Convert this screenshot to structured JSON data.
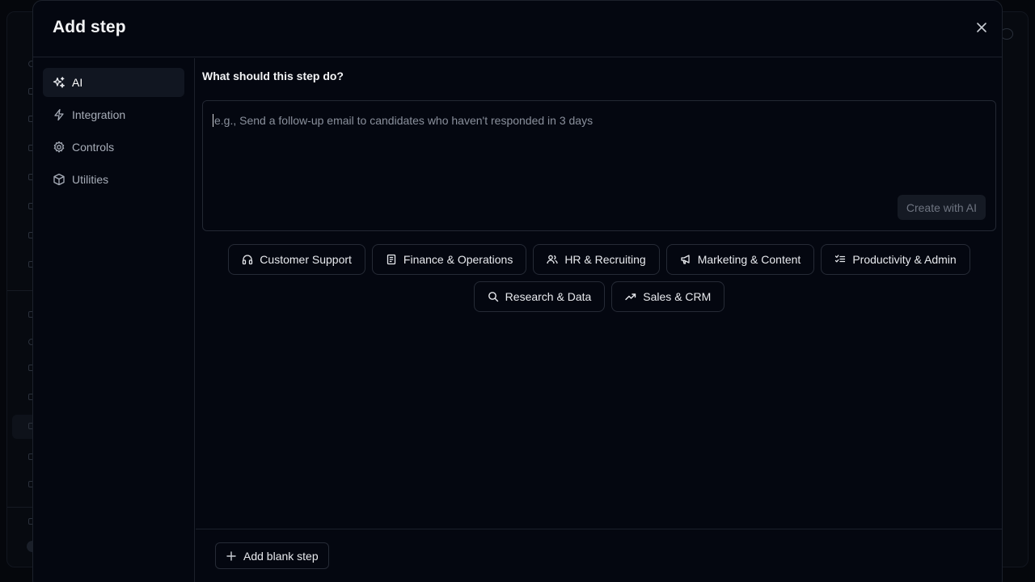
{
  "modal": {
    "title": "Add step"
  },
  "sidebar": {
    "items": [
      {
        "label": "AI",
        "icon": "sparkles-icon",
        "active": true
      },
      {
        "label": "Integration",
        "icon": "lightning-icon",
        "active": false
      },
      {
        "label": "Controls",
        "icon": "gear-icon",
        "active": false
      },
      {
        "label": "Utilities",
        "icon": "cube-icon",
        "active": false
      }
    ]
  },
  "prompt": {
    "label": "What should this step do?",
    "placeholder": "e.g., Send a follow-up email to candidates who haven't responded in 3 days",
    "create_label": "Create with AI"
  },
  "categories": [
    {
      "label": "Customer Support",
      "icon": "headphones-icon"
    },
    {
      "label": "Finance & Operations",
      "icon": "receipt-icon"
    },
    {
      "label": "HR & Recruiting",
      "icon": "users-icon"
    },
    {
      "label": "Marketing & Content",
      "icon": "megaphone-icon"
    },
    {
      "label": "Productivity & Admin",
      "icon": "checklist-icon"
    },
    {
      "label": "Research & Data",
      "icon": "search-icon"
    },
    {
      "label": "Sales & CRM",
      "icon": "trending-up-icon"
    }
  ],
  "footer": {
    "add_blank_label": "Add blank step"
  },
  "colors": {
    "background": "#05070c",
    "modal": "#040710",
    "border": "#1c212b",
    "active_nav": "#111621"
  }
}
